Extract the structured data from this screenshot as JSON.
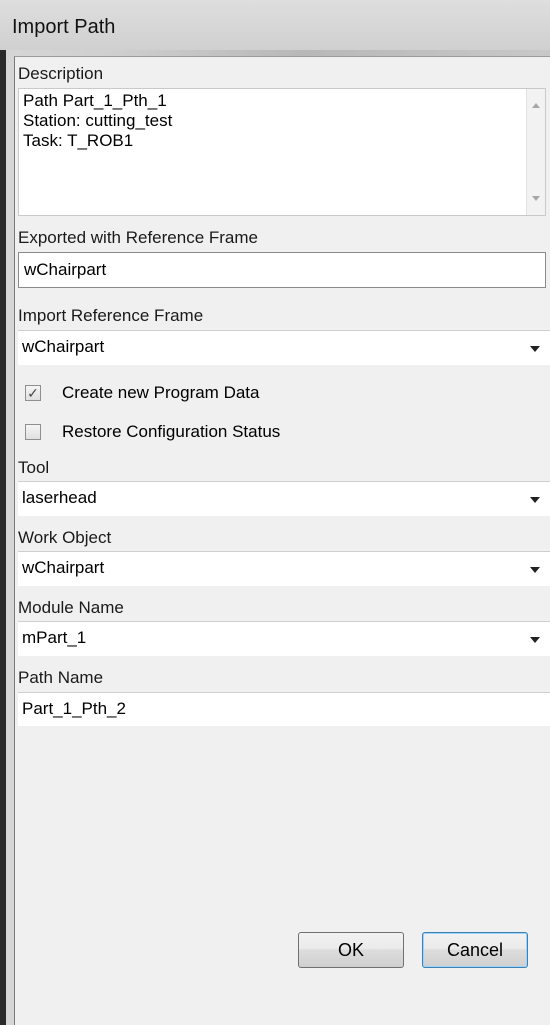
{
  "window": {
    "title": "Import Path"
  },
  "description": {
    "label": "Description",
    "lines": [
      "Path Part_1_Pth_1",
      "Station: cutting_test",
      "Task: T_ROB1"
    ]
  },
  "exported_ref": {
    "label": "Exported with Reference Frame",
    "value": "wChairpart"
  },
  "import_ref": {
    "label": "Import Reference Frame",
    "value": "wChairpart"
  },
  "create_program_data": {
    "label": "Create new Program Data",
    "checked": true,
    "mark": "✓"
  },
  "restore_config": {
    "label": "Restore Configuration Status",
    "checked": false
  },
  "tool": {
    "label": "Tool",
    "value": "laserhead"
  },
  "work_object": {
    "label": "Work Object",
    "value": "wChairpart"
  },
  "module_name": {
    "label": "Module Name",
    "value": "mPart_1"
  },
  "path_name": {
    "label": "Path Name",
    "value": "Part_1_Pth_2"
  },
  "buttons": {
    "ok": "OK",
    "cancel": "Cancel"
  }
}
